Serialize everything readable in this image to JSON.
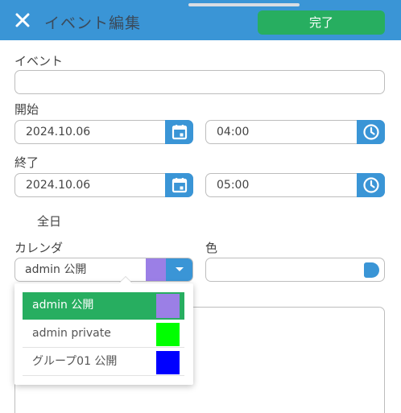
{
  "header": {
    "title": "イベント編集",
    "done_label": "完了"
  },
  "form": {
    "event_label": "イベント",
    "event_value": "",
    "start_label": "開始",
    "start_date": "2024.10.06",
    "start_time": "04:00",
    "end_label": "終了",
    "end_date": "2024.10.06",
    "end_time": "05:00",
    "allday_label": "全日",
    "calendar_label": "カレンダ",
    "calendar_selected": "admin 公開",
    "calendar_selected_color": "#9b7fe6",
    "color_label": "色"
  },
  "calendar_options": [
    {
      "label": "admin 公開",
      "color": "#9b7fe6",
      "selected": true
    },
    {
      "label": "admin private",
      "color": "#00ff00",
      "selected": false
    },
    {
      "label": "グループ01 公開",
      "color": "#0000ff",
      "selected": false
    }
  ],
  "colors": {
    "accent": "#3a95d6",
    "done": "#27ae60"
  },
  "icons": {
    "close": "close-icon",
    "calendar": "calendar-icon",
    "clock": "clock-icon",
    "dropdown": "chevron-down-icon"
  }
}
